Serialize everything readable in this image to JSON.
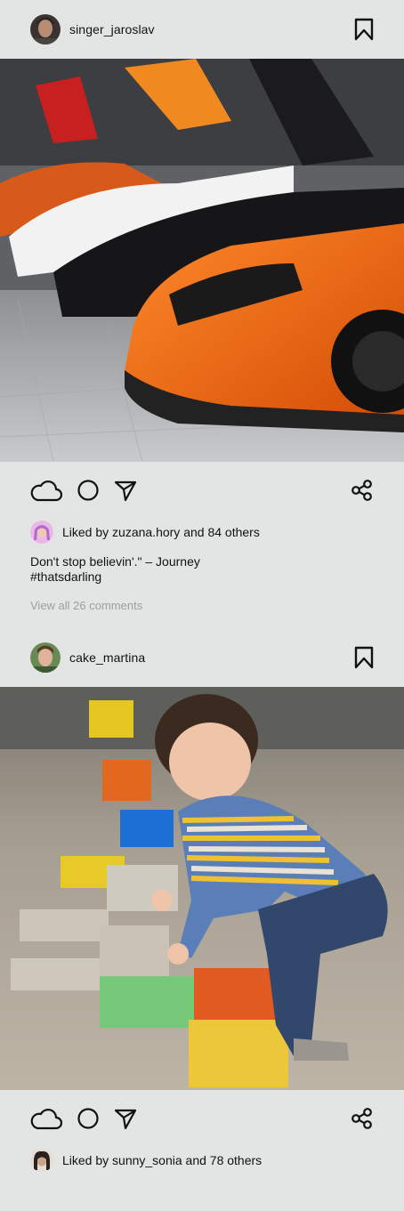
{
  "posts": [
    {
      "username": "singer_jaroslav",
      "image_alt": "orange supercar lineup",
      "likes_text": "Liked by zuzana.hory and 84 others",
      "caption_line1": "Don't stop believin'.\" – Journey",
      "caption_line2": "#thatsdarling",
      "comments_link": "View all 26 comments"
    },
    {
      "username": "cake_martina",
      "image_alt": "child playing with colored blocks",
      "likes_text": "Liked by sunny_sonia and 78 others"
    }
  ],
  "icons": [
    "bookmark-icon",
    "cloud-icon",
    "circle-icon",
    "send-icon",
    "share-icon"
  ]
}
